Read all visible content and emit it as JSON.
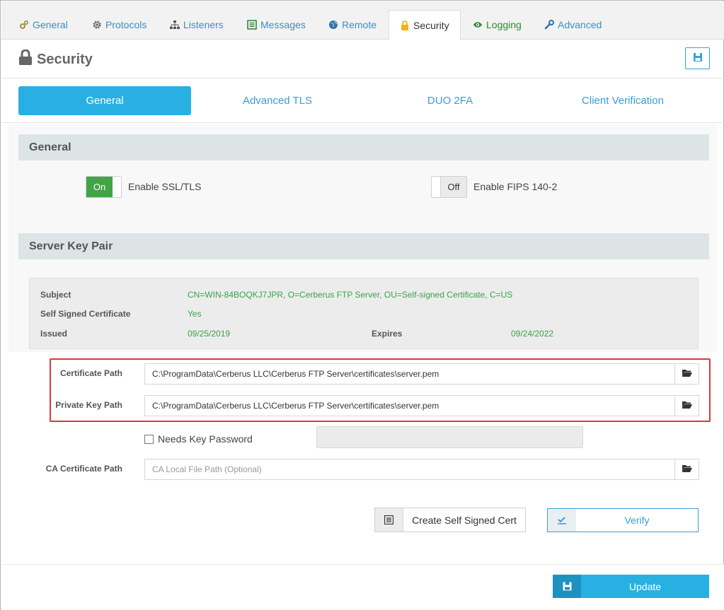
{
  "top_tabs": [
    {
      "label": "General",
      "icon": "gears-icon"
    },
    {
      "label": "Protocols",
      "icon": "gear-icon"
    },
    {
      "label": "Listeners",
      "icon": "sitemap-icon"
    },
    {
      "label": "Messages",
      "icon": "list-icon"
    },
    {
      "label": "Remote",
      "icon": "globe-icon"
    },
    {
      "label": "Security",
      "icon": "lock-icon"
    },
    {
      "label": "Logging",
      "icon": "eye-icon"
    },
    {
      "label": "Advanced",
      "icon": "wrench-icon"
    }
  ],
  "page": {
    "title": "Security"
  },
  "sub_tabs": [
    {
      "label": "General"
    },
    {
      "label": "Advanced TLS"
    },
    {
      "label": "DUO 2FA"
    },
    {
      "label": "Client Verification"
    }
  ],
  "general_section": {
    "title": "General",
    "ssl_toggle": {
      "state": "On",
      "label": "Enable SSL/TLS"
    },
    "fips_toggle": {
      "state": "Off",
      "label": "Enable FIPS 140-2"
    }
  },
  "key_pair": {
    "title": "Server Key Pair",
    "subject_label": "Subject",
    "subject_value": "CN=WIN-84BOQKJ7JPR, O=Cerberus FTP Server, OU=Self-signed Certificate, C=US",
    "self_signed_label": "Self Signed Certificate",
    "self_signed_value": "Yes",
    "issued_label": "Issued",
    "issued_value": "09/25/2019",
    "expires_label": "Expires",
    "expires_value": "09/24/2022",
    "cert_path_label": "Certificate Path",
    "cert_path_value": "C:\\ProgramData\\Cerberus LLC\\Cerberus FTP Server\\certificates\\server.pem",
    "private_key_label": "Private Key Path",
    "private_key_value": "C:\\ProgramData\\Cerberus LLC\\Cerberus FTP Server\\certificates\\server.pem",
    "needs_password_label": "Needs Key Password",
    "ca_path_label": "CA Certificate Path",
    "ca_path_placeholder": "CA Local File Path (Optional)",
    "create_cert_label": "Create Self Signed Cert",
    "verify_label": "Verify"
  },
  "footer": {
    "update_label": "Update"
  },
  "colors": {
    "accent": "#29b0e3",
    "success": "#43a447",
    "highlight": "#d9383a"
  }
}
